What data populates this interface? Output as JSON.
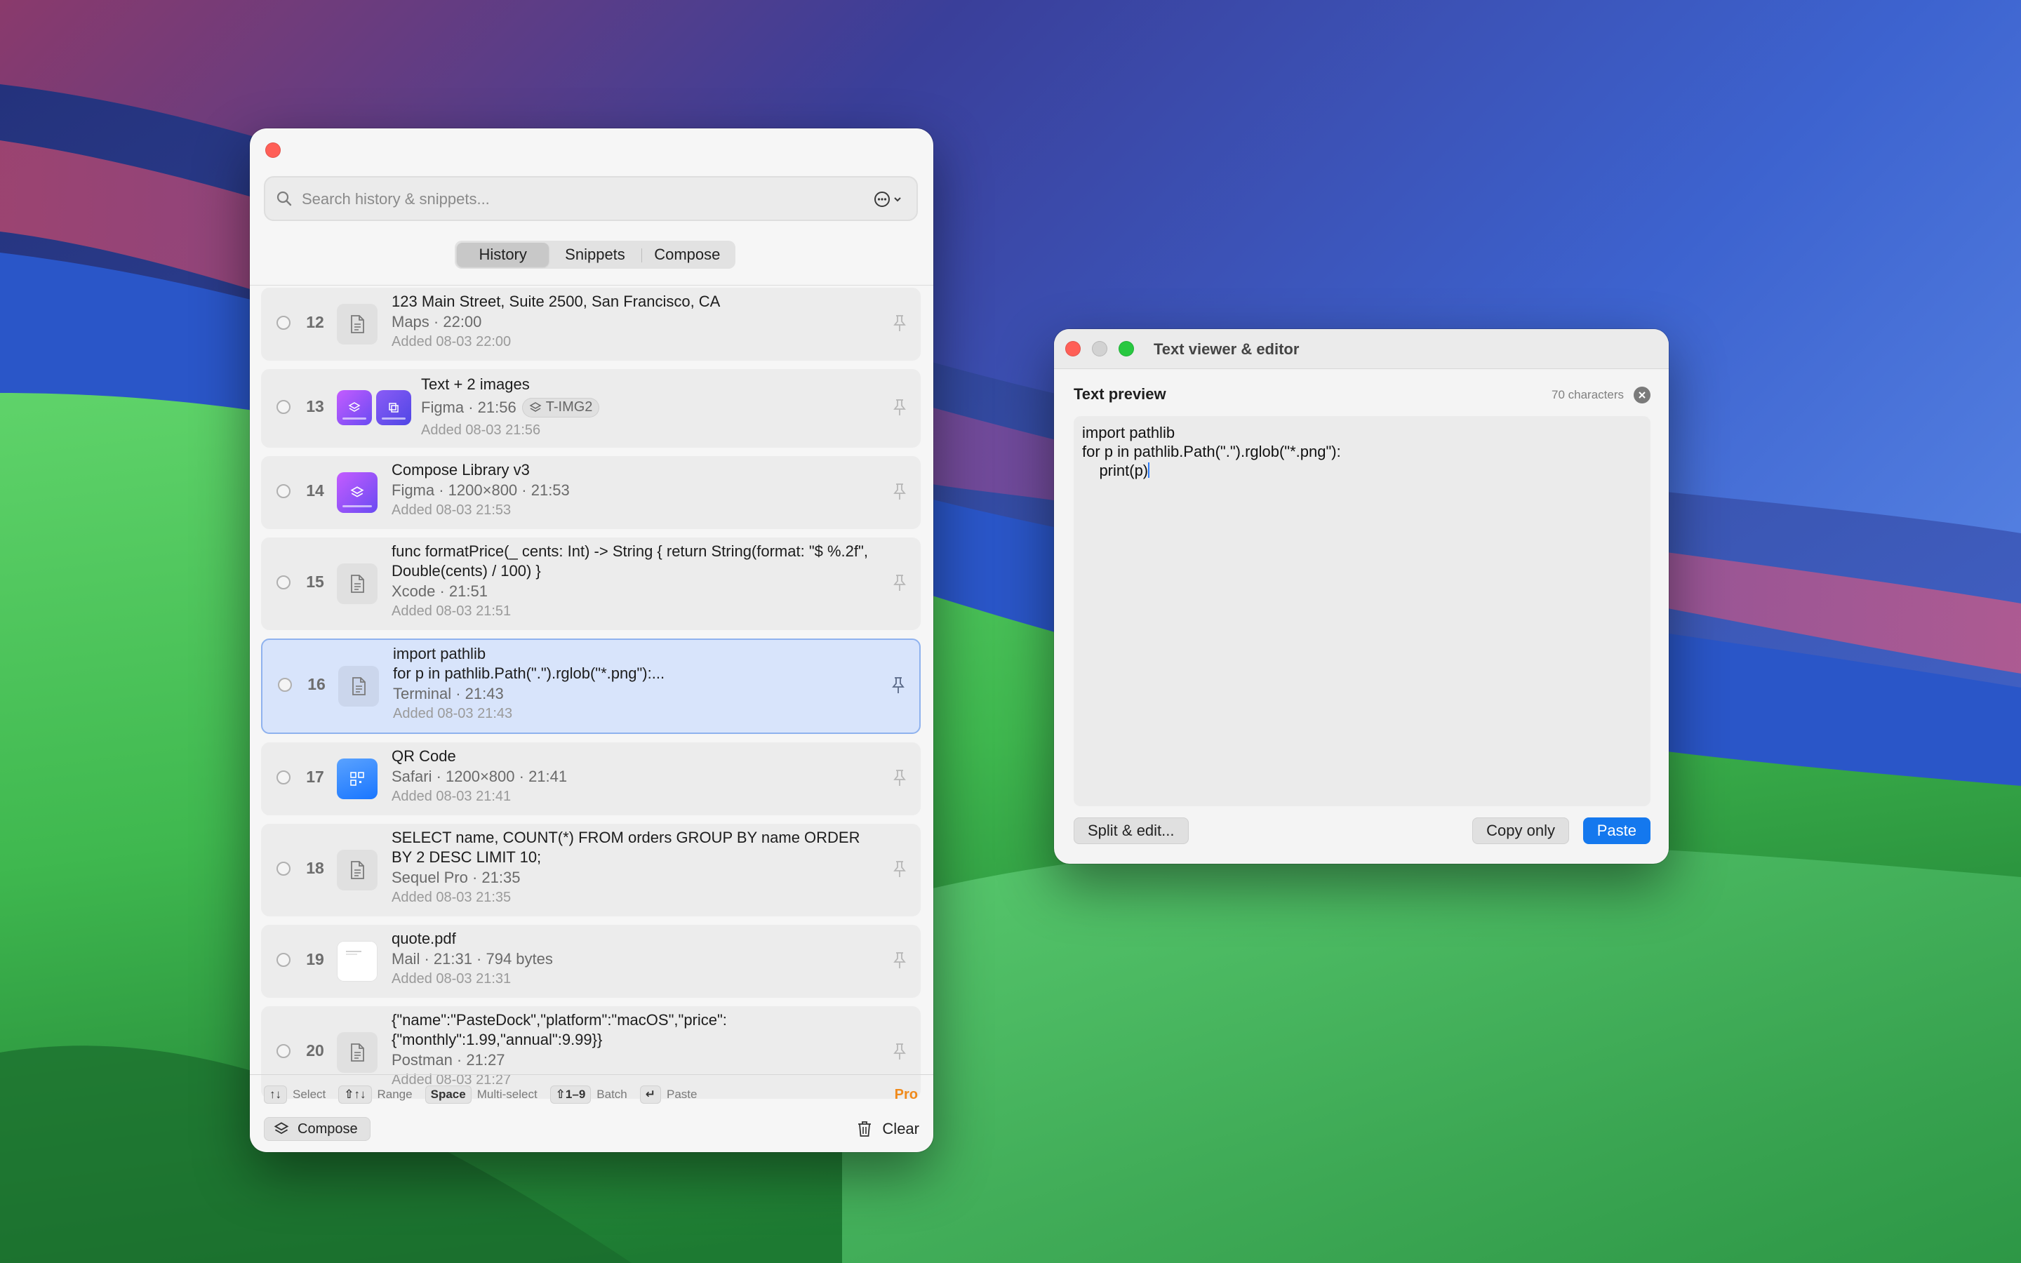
{
  "colors": {
    "accent": "#1478ee",
    "selected_row_bg": "#d8e4fb",
    "pro": "#f08a1b",
    "close": "#ff5f57",
    "maximize": "#28c840"
  },
  "panel": {
    "search": {
      "placeholder": "Search history & snippets..."
    },
    "tabs": [
      {
        "label": "History",
        "active": true
      },
      {
        "label": "Snippets",
        "active": false
      },
      {
        "label": "Compose",
        "active": false
      }
    ],
    "rows": [
      {
        "num": "12",
        "title": "123 Main Street, Suite 2500, San Francisco, CA",
        "meta": "Maps · 22:00",
        "added": "Added 08-03 22:00",
        "icon": "document-icon"
      },
      {
        "num": "13",
        "title": "Text + 2 images",
        "meta": "Figma · 21:56",
        "badge": "T-IMG2",
        "added": "Added 08-03 21:56",
        "icon": "image-thumbnails"
      },
      {
        "num": "14",
        "title": "Compose Library v3",
        "meta": "Figma · 1200×800 · 21:53",
        "added": "Added 08-03 21:53",
        "icon": "image-thumbnail"
      },
      {
        "num": "15",
        "title": "func formatPrice(_ cents: Int) -> String { return String(format: \"$ %.2f\", Double(cents) / 100) }",
        "meta": "Xcode · 21:51",
        "added": "Added 08-03 21:51",
        "icon": "document-icon"
      },
      {
        "num": "16",
        "title_line1": "import pathlib",
        "title_line2": "for p in pathlib.Path(\".\").rglob(\"*.png\"):...",
        "meta": "Terminal · 21:43",
        "added": "Added 08-03 21:43",
        "selected": true,
        "icon": "document-icon"
      },
      {
        "num": "17",
        "title": "QR Code",
        "meta": "Safari · 1200×800 · 21:41",
        "added": "Added 08-03 21:41",
        "icon": "qr-thumbnail"
      },
      {
        "num": "18",
        "title": "SELECT name, COUNT(*) FROM orders GROUP BY name ORDER BY 2 DESC LIMIT 10;",
        "meta": "Sequel Pro · 21:35",
        "added": "Added 08-03 21:35",
        "icon": "document-icon"
      },
      {
        "num": "19",
        "title": "quote.pdf",
        "meta": "Mail · 21:31 · 794 bytes",
        "added": "Added 08-03 21:31",
        "icon": "pdf-thumbnail"
      },
      {
        "num": "20",
        "title": "{\"name\":\"PasteDock\",\"platform\":\"macOS\",\"price\": {\"monthly\":1.99,\"annual\":9.99}}",
        "meta": "Postman · 21:27",
        "added": "Added 08-03 21:27",
        "icon": "document-icon"
      }
    ],
    "shortcuts": [
      {
        "key": "↑↓",
        "label": "Select"
      },
      {
        "key": "⇧↑↓",
        "label": "Range"
      },
      {
        "key": "Space",
        "label": "Multi-select"
      },
      {
        "key": "⇧1–9",
        "label": "Batch"
      },
      {
        "key": "↵",
        "label": "Paste"
      }
    ],
    "pro_label": "Pro",
    "compose_button": "Compose",
    "clear_button": "Clear"
  },
  "viewer": {
    "window_title": "Text viewer & editor",
    "section_title": "Text preview",
    "char_count": "70 characters",
    "lines": [
      "import pathlib",
      "for p in pathlib.Path(\".\").rglob(\"*.png\"):",
      "    print(p)"
    ],
    "split_button": "Split & edit...",
    "copy_button": "Copy only",
    "paste_button": "Paste"
  }
}
